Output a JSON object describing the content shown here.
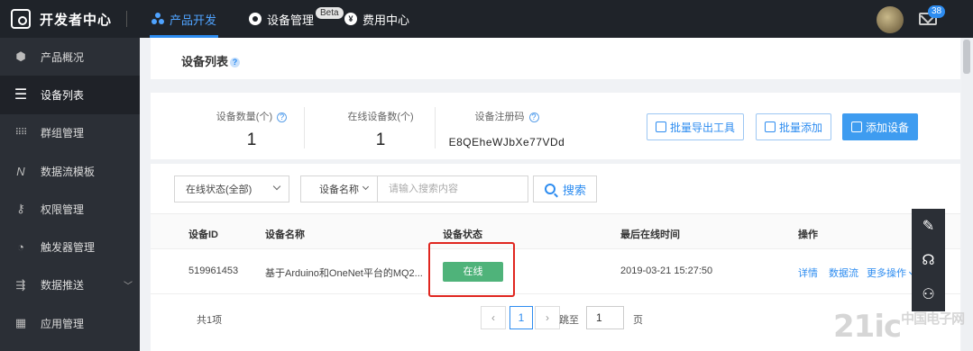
{
  "brand": {
    "title": "开发者中心"
  },
  "topnav": {
    "product": "产品开发",
    "device": "设备管理",
    "beta": "Beta",
    "fee": "费用中心",
    "mail_badge": "38",
    "accent": "#2d8cf0"
  },
  "sidebar": {
    "items": [
      {
        "label": "产品概况",
        "icon": "cube-icon"
      },
      {
        "label": "设备列表",
        "icon": "list-icon",
        "active": true
      },
      {
        "label": "群组管理",
        "icon": "grid-dots-icon"
      },
      {
        "label": "数据流模板",
        "icon": "datastream-icon"
      },
      {
        "label": "权限管理",
        "icon": "key-icon"
      },
      {
        "label": "触发器管理",
        "icon": "gauge-icon"
      },
      {
        "label": "数据推送",
        "icon": "push-icon"
      },
      {
        "label": "应用管理",
        "icon": "apps-icon"
      }
    ]
  },
  "page": {
    "title": "设备列表"
  },
  "stats": {
    "count_label": "设备数量(个)",
    "count_value": "1",
    "online_label": "在线设备数(个)",
    "online_value": "1",
    "regcode_label": "设备注册码",
    "regcode_value": "E8QEheWJbXe77VDd",
    "export_btn": "批量导出工具",
    "batch_add_btn": "批量添加",
    "add_btn": "添加设备"
  },
  "filters": {
    "status_select": "在线状态(全部)",
    "field_select": "设备名称",
    "search_placeholder": "请输入搜索内容",
    "search_btn": "搜索"
  },
  "table": {
    "headers": [
      "设备ID",
      "设备名称",
      "设备状态",
      "最后在线时间",
      "操作"
    ],
    "rows": [
      {
        "id": "519961453",
        "name": "基于Arduino和OneNet平台的MQ2...",
        "status": "在线",
        "last_online": "2019-03-21 15:27:50",
        "action_detail": "详情",
        "action_stream": "数据流",
        "action_more": "更多操作"
      }
    ],
    "status_color": "#4fb37a"
  },
  "pagination": {
    "total": "共1项",
    "prev": "‹",
    "page": "1",
    "next": "›",
    "goto_label": "跳至",
    "goto_value": "1",
    "page_unit": "页"
  },
  "watermark": {
    "main": "21ic",
    "small": "中国电子网"
  }
}
